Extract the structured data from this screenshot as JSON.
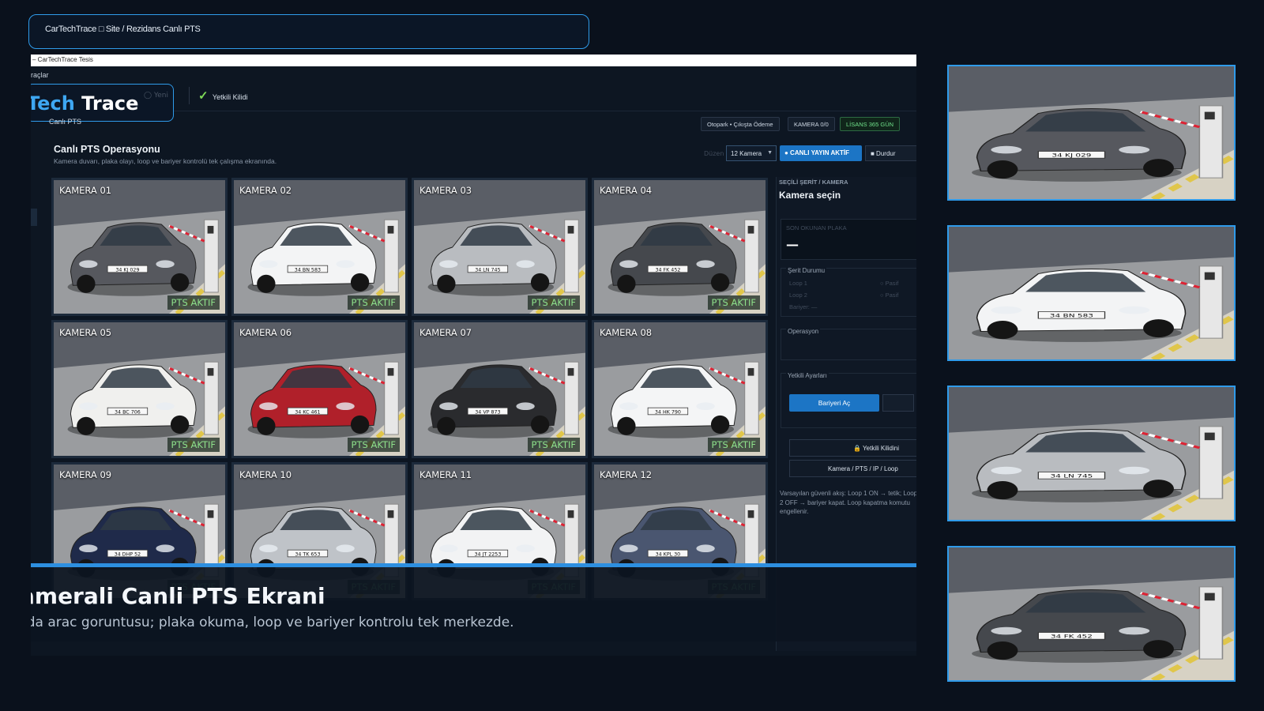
{
  "topbar": {
    "text": "CarTechTrace □ Site / Rezidans Canlı PTS"
  },
  "window": {
    "title": "– CarTechTrace Tesis",
    "menu_item": "raçlar"
  },
  "logo": {
    "part1": "Tech",
    "part2": "Trace"
  },
  "toolbar": {
    "faded_label": "Yeni",
    "lock_label": "Yetkili Kilidi"
  },
  "breadcrumb": "Canlı PTS",
  "chips": {
    "parking": "Otopark • Çıkışta Ödeme",
    "camera": "KAMERA 0/0",
    "license": "LİSANS 365 GÜN"
  },
  "ops": {
    "title": "Canlı PTS Operasyonu",
    "subtitle": "Kamera duvarı, plaka olayı, loop ve bariyer kontrolü tek çalışma ekranında.",
    "faint_label": "Düzen",
    "select_value": "12 Kamera",
    "live_button": "● CANLI YAYIN AKTİF",
    "stop_button": "■ Durdur"
  },
  "cameras": [
    {
      "label": "KAMERA 01",
      "status": "PTS AKTIF",
      "color": "#56585e"
    },
    {
      "label": "KAMERA 02",
      "status": "PTS AKTIF",
      "color": "#f3f4f5"
    },
    {
      "label": "KAMERA 03",
      "status": "PTS AKTIF",
      "color": "#b9bcc0"
    },
    {
      "label": "KAMERA 04",
      "status": "PTS AKTIF",
      "color": "#45484d"
    },
    {
      "label": "KAMERA 05",
      "status": "PTS AKTIF",
      "color": "#f0f0ee"
    },
    {
      "label": "KAMERA 06",
      "status": "PTS AKTIF",
      "color": "#b0202a"
    },
    {
      "label": "KAMERA 07",
      "status": "PTS AKTIF",
      "color": "#2a2b2e"
    },
    {
      "label": "KAMERA 08",
      "status": "PTS AKTIF",
      "color": "#f4f5f6"
    },
    {
      "label": "KAMERA 09",
      "status": "PTS AKTIF",
      "color": "#1f2a4a"
    },
    {
      "label": "KAMERA 10",
      "status": "PTS AKTIF",
      "color": "#bfc3c8"
    },
    {
      "label": "KAMERA 11",
      "status": "PTS AKTIF",
      "color": "#f2f3f4"
    },
    {
      "label": "KAMERA 12",
      "status": "PTS AKTIF",
      "color": "#4a5670"
    }
  ],
  "panel": {
    "caption": "SEÇİLİ ŞERİT / KAMERA",
    "title": "Kamera seçin",
    "plate_caption": "SON OKUNAN PLAKA",
    "plate_value": "—",
    "lane_status_label": "Şerit Durumu",
    "loop1": "Loop 1",
    "loop2": "Loop 2",
    "barrier": "Bariyer: —",
    "loop1_state": "○ Pasif",
    "loop2_state": "○ Pasif",
    "operation_label": "Operasyon",
    "open_barrier": "Bariyeri Aç",
    "authorized_settings_label": "Yetkili Ayarları",
    "lock_button": "🔒 Yetkili Kilidini",
    "camera_settings_button": "Kamera / PTS / IP / Loop",
    "note": "Varsayılan güvenli akış: Loop 1 ON → tetik; Loop 2 OFF → bariyer kapat. Loop kapatma komutu engellenir."
  },
  "banner": {
    "title": "amerali Canli PTS Ekrani",
    "subtitle": "ıda arac goruntusu; plaka okuma, loop ve bariyer kontrolu tek merkezde."
  },
  "thumbs": [
    {
      "color": "#56585e",
      "plate": "34 KJ 029"
    },
    {
      "color": "#f3f4f5",
      "plate": "34 BN 583"
    },
    {
      "color": "#b9bcc0",
      "plate": "34 LN 745"
    },
    {
      "color": "#45484d",
      "plate": "34 FK 452"
    }
  ]
}
